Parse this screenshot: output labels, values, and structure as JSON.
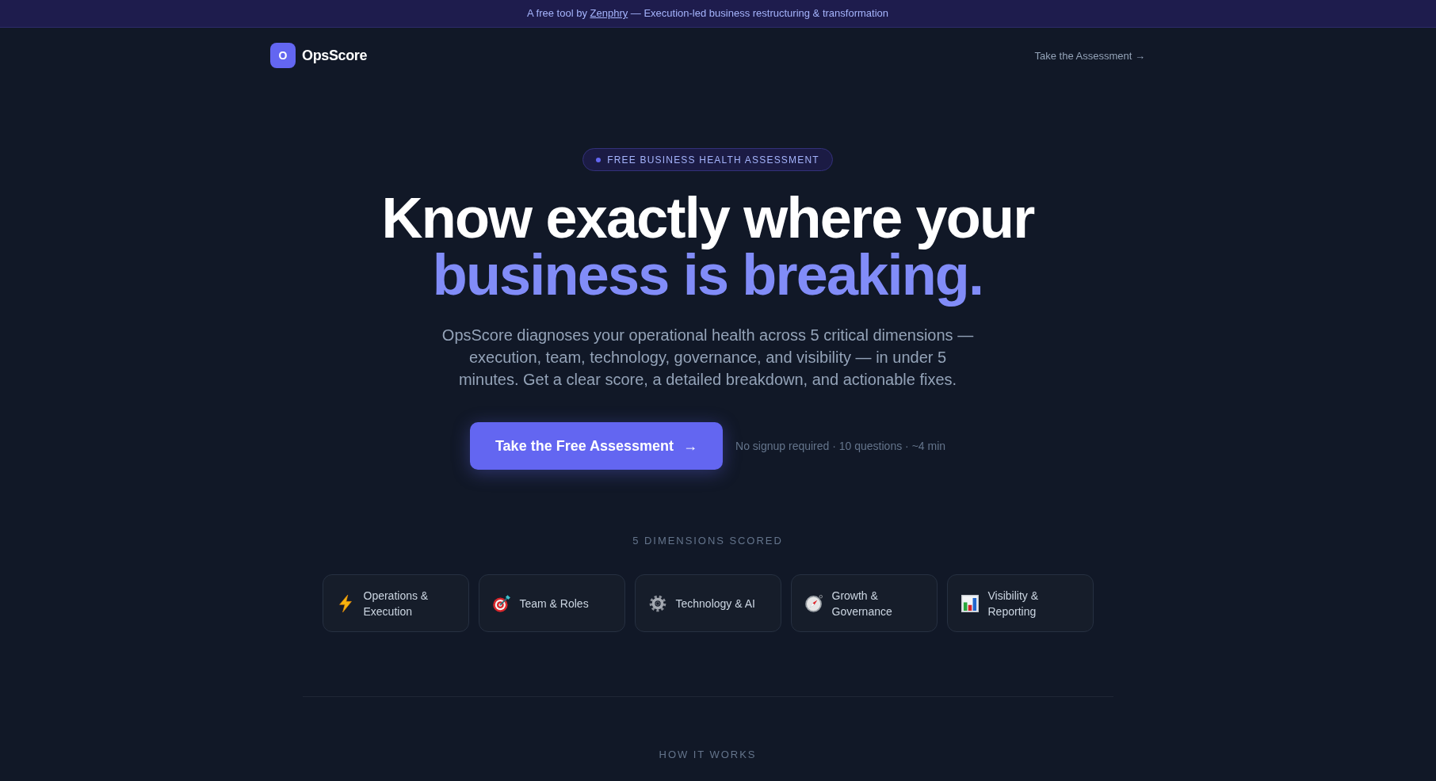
{
  "banner": {
    "prefix": "A free tool by",
    "link": "Zenphry",
    "suffix": "— Execution-led business restructuring & transformation"
  },
  "nav": {
    "logo_mark": "O",
    "brand": "OpsScore",
    "link": "Take the Assessment →"
  },
  "hero": {
    "badge": "FREE BUSINESS HEALTH ASSESSMENT",
    "headline": "Know exactly where your",
    "headline_highlight": "business is breaking.",
    "description": "OpsScore diagnoses your operational health across 5 critical dimensions — execution, team, technology, governance, and visibility — in under 5 minutes. Get a clear score, a detailed breakdown, and actionable fixes.",
    "cta": {
      "label": "Take the Free Assessment",
      "arrow": "→"
    },
    "note": "No signup required · 10 questions · ~4 min"
  },
  "dimensions": {
    "heading": "5 DIMENSIONS SCORED",
    "items": [
      {
        "label": "Operations & Execution"
      },
      {
        "label": "Team & Roles"
      },
      {
        "label": "Technology & AI"
      },
      {
        "label": "Growth & Governance"
      },
      {
        "label": "Visibility & Reporting"
      }
    ]
  },
  "how_it_works": {
    "heading": "HOW IT WORKS"
  }
}
